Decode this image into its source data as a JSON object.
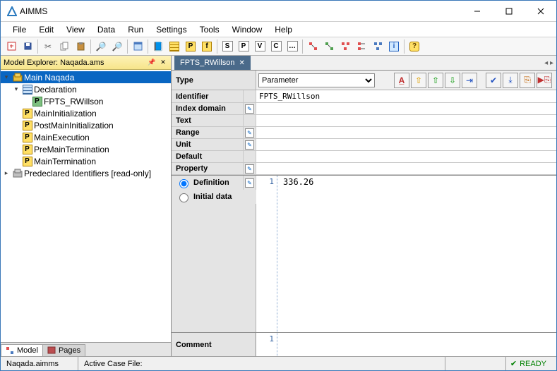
{
  "titlebar": {
    "app_name": "AIMMS"
  },
  "menu": [
    "File",
    "Edit",
    "View",
    "Data",
    "Run",
    "Settings",
    "Tools",
    "Window",
    "Help"
  ],
  "explorer": {
    "title": "Model Explorer: Naqada.ams",
    "root": "Main Naqada",
    "decl_section": "Declaration",
    "decl_item": "FPTS_RWillson",
    "procs": [
      "MainInitialization",
      "PostMainInitialization",
      "MainExecution",
      "PreMainTermination",
      "MainTermination"
    ],
    "predeclared": "Predeclared Identifiers [read-only]"
  },
  "left_tabs": {
    "model": "Model",
    "pages": "Pages"
  },
  "editor_tab": "FPTS_RWillson",
  "form": {
    "type_label": "Type",
    "type_value": "Parameter",
    "identifier_label": "Identifier",
    "identifier_value": "FPTS_RWillson",
    "index_domain": "Index domain",
    "text": "Text",
    "range": "Range",
    "unit": "Unit",
    "default": "Default",
    "property": "Property",
    "definition": "Definition",
    "initial_data": "Initial data",
    "comment": "Comment",
    "line_no": "1",
    "definition_value": "336.26"
  },
  "status": {
    "file": "Naqada.aimms",
    "case_label": "Active Case File:",
    "ready": "READY"
  }
}
